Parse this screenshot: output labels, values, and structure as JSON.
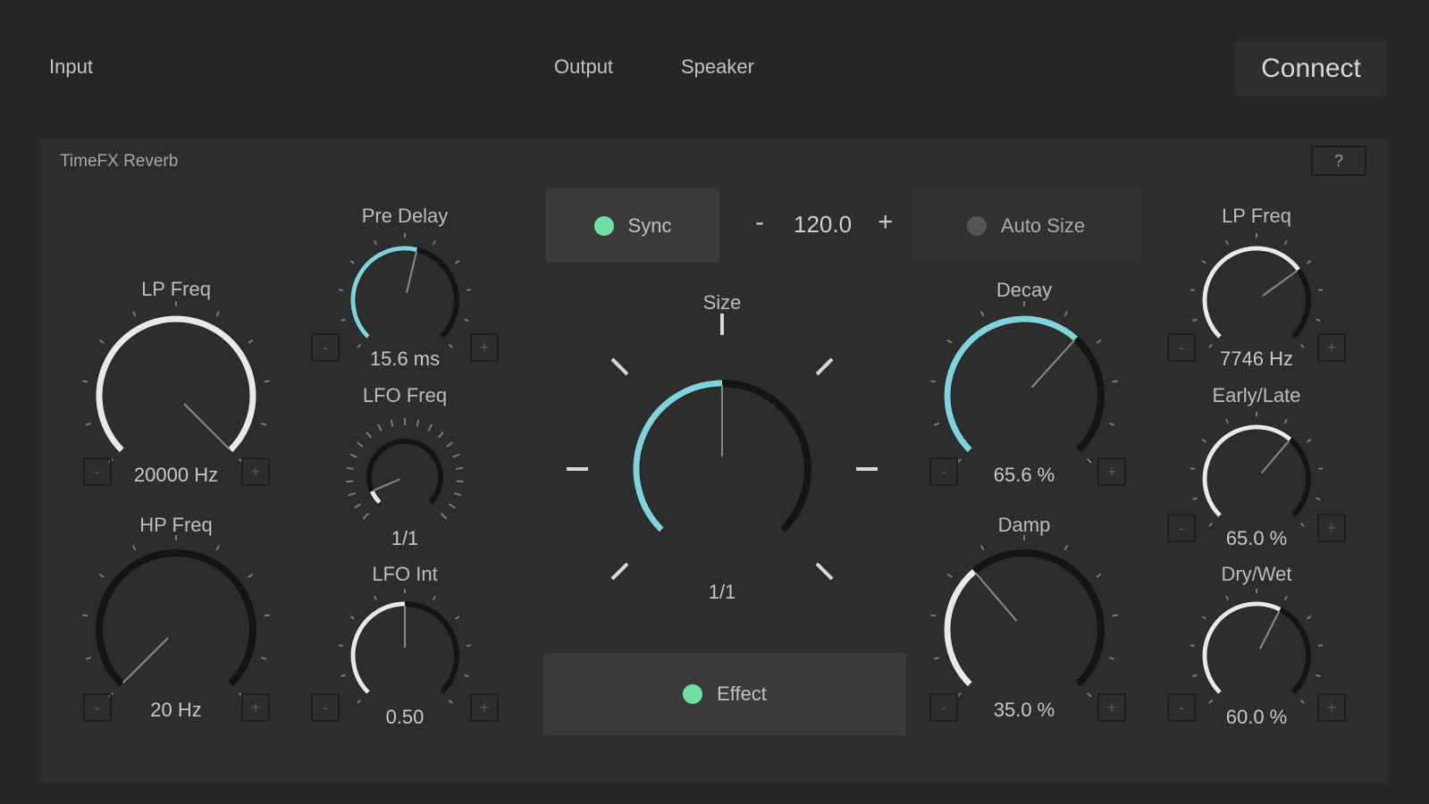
{
  "topbar": {
    "input_label": "Input",
    "output_label": "Output",
    "speaker_label": "Speaker",
    "connect_label": "Connect"
  },
  "panel": {
    "title": "TimeFX Reverb",
    "help_label": "?"
  },
  "colors": {
    "accent": "#7fd3dc",
    "led_on": "#6fe0a3",
    "led_off": "#555555",
    "knob_track": "#141414",
    "arc_white": "#e9e9e9"
  },
  "icons": {
    "minus": "minus-icon",
    "plus": "plus-icon",
    "led": "led-indicator-icon"
  },
  "sync": {
    "label": "Sync",
    "active": true
  },
  "tempo": {
    "minus_label": "-",
    "value": "120.0",
    "plus_label": "+"
  },
  "auto_size": {
    "label": "Auto Size",
    "active": false
  },
  "effect": {
    "label": "Effect",
    "active": true
  },
  "stepper_labels": {
    "minus": "-",
    "plus": "+"
  },
  "knobs": {
    "lp_freq_left": {
      "label": "LP Freq",
      "value": "20000 Hz",
      "level": 1.0,
      "arc": "white"
    },
    "hp_freq": {
      "label": "HP Freq",
      "value": "20 Hz",
      "level": 0.0,
      "arc": "white"
    },
    "pre_delay": {
      "label": "Pre Delay",
      "value": "15.6 ms",
      "level": 0.55,
      "arc": "accent"
    },
    "lfo_freq": {
      "label": "LFO Freq",
      "value": "1/1",
      "level": 0.08,
      "arc": "white"
    },
    "lfo_int": {
      "label": "LFO Int",
      "value": "0.50",
      "level": 0.5,
      "arc": "white"
    },
    "size": {
      "label": "Size",
      "value": "1/1",
      "level": 0.5,
      "arc": "accent"
    },
    "decay": {
      "label": "Decay",
      "value": "65.6 %",
      "level": 0.656,
      "arc": "accent"
    },
    "damp": {
      "label": "Damp",
      "value": "35.0 %",
      "level": 0.35,
      "arc": "white"
    },
    "lp_freq_right": {
      "label": "LP Freq",
      "value": "7746 Hz",
      "level": 0.7,
      "arc": "white"
    },
    "early_late": {
      "label": "Early/Late",
      "value": "65.0 %",
      "level": 0.65,
      "arc": "white"
    },
    "dry_wet": {
      "label": "Dry/Wet",
      "value": "60.0 %",
      "level": 0.6,
      "arc": "white"
    }
  }
}
